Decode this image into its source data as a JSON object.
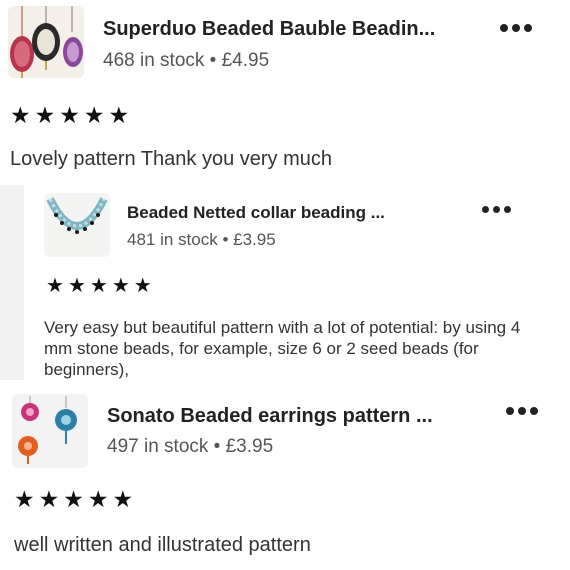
{
  "reviews": [
    {
      "item_title": "Superduo Beaded Bauble Beadin...",
      "item_meta": "468 in stock • £4.95",
      "rating_icons": [
        "★",
        "★",
        "★",
        "★",
        "★"
      ],
      "review_text": "Lovely pattern  Thank you very much",
      "more_icon": "ellipsis-icon"
    },
    {
      "item_title": "Beaded Netted collar beading ...",
      "item_meta": "481 in stock • £3.95",
      "rating_icons": [
        "★",
        "★",
        "★",
        "★",
        "★"
      ],
      "review_text": "Very easy but beautiful pattern with a lot of potential: by using 4 mm stone beads, for example, size 6 or 2 seed beads (for beginners),",
      "more_icon": "ellipsis-icon"
    },
    {
      "item_title": "Sonato Beaded earrings pattern ...",
      "item_meta": "497 in stock • £3.95",
      "rating_icons": [
        "★",
        "★",
        "★",
        "★",
        "★"
      ],
      "review_text": "well written and illustrated pattern",
      "more_icon": "ellipsis-icon"
    }
  ],
  "colors": {
    "text": "#222222",
    "muted": "#555555",
    "background": "#ffffff",
    "divider_gray": "#f2f2f2"
  }
}
